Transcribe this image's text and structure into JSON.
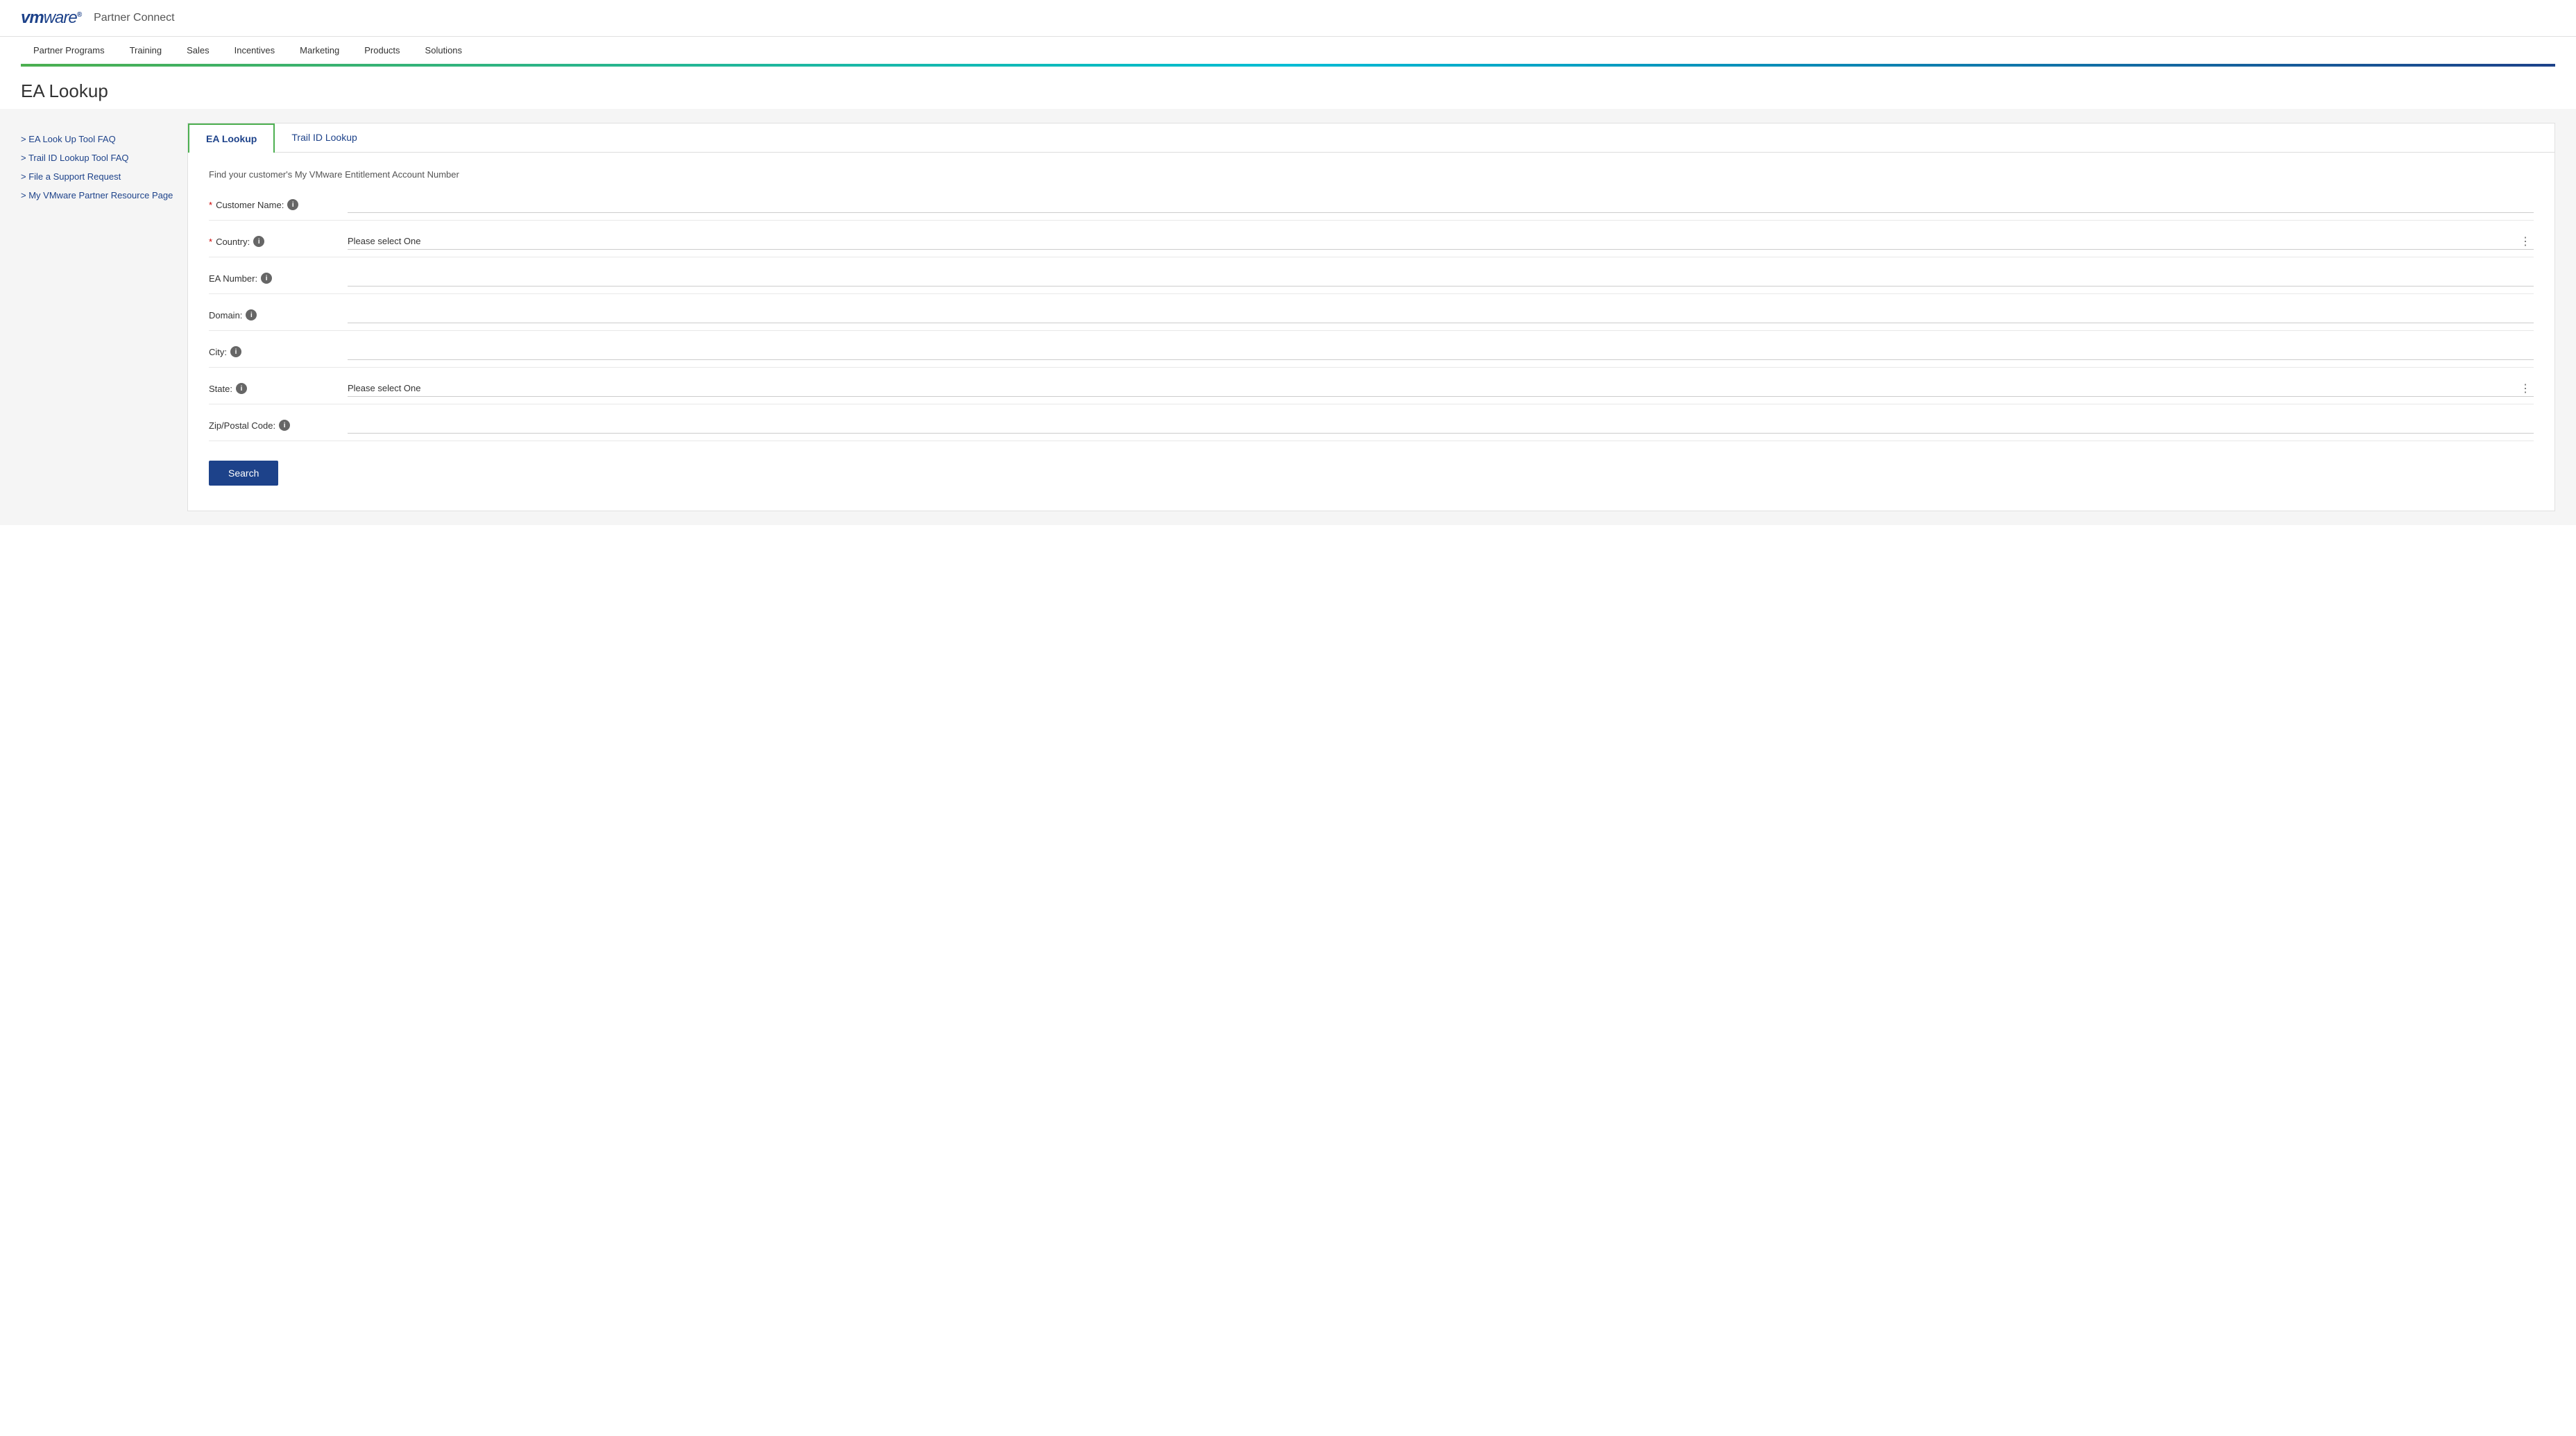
{
  "header": {
    "logo_vm": "vm",
    "logo_ware": "ware",
    "logo_symbol": "■",
    "partner_connect": "Partner Connect"
  },
  "nav": {
    "items": [
      {
        "label": "Partner Programs"
      },
      {
        "label": "Training"
      },
      {
        "label": "Sales"
      },
      {
        "label": "Incentives"
      },
      {
        "label": "Marketing"
      },
      {
        "label": "Products"
      },
      {
        "label": "Solutions"
      }
    ]
  },
  "page": {
    "title": "EA Lookup"
  },
  "sidebar": {
    "links": [
      {
        "label": "EA Look Up Tool FAQ"
      },
      {
        "label": "Trail ID Lookup Tool FAQ"
      },
      {
        "label": "File a Support Request"
      },
      {
        "label": "My VMware Partner Resource Page"
      }
    ]
  },
  "tabs": [
    {
      "label": "EA Lookup",
      "active": true
    },
    {
      "label": "Trail ID Lookup",
      "active": false
    }
  ],
  "form": {
    "description": "Find your customer's My VMware Entitlement Account Number",
    "fields": [
      {
        "id": "customer-name",
        "label": "Customer Name:",
        "required": true,
        "type": "text",
        "placeholder": ""
      },
      {
        "id": "country",
        "label": "Country:",
        "required": true,
        "type": "select",
        "placeholder": "Please select One"
      },
      {
        "id": "ea-number",
        "label": "EA Number:",
        "required": false,
        "type": "text",
        "placeholder": ""
      },
      {
        "id": "domain",
        "label": "Domain:",
        "required": false,
        "type": "text",
        "placeholder": ""
      },
      {
        "id": "city",
        "label": "City:",
        "required": false,
        "type": "text",
        "placeholder": ""
      },
      {
        "id": "state",
        "label": "State:",
        "required": false,
        "type": "select",
        "placeholder": "Please select One"
      },
      {
        "id": "zip",
        "label": "Zip/Postal Code:",
        "required": false,
        "type": "text",
        "placeholder": ""
      }
    ],
    "search_button": "Search"
  },
  "colors": {
    "primary": "#1d428a",
    "accent_green": "#4CAF50",
    "accent_teal": "#00BCD4"
  }
}
